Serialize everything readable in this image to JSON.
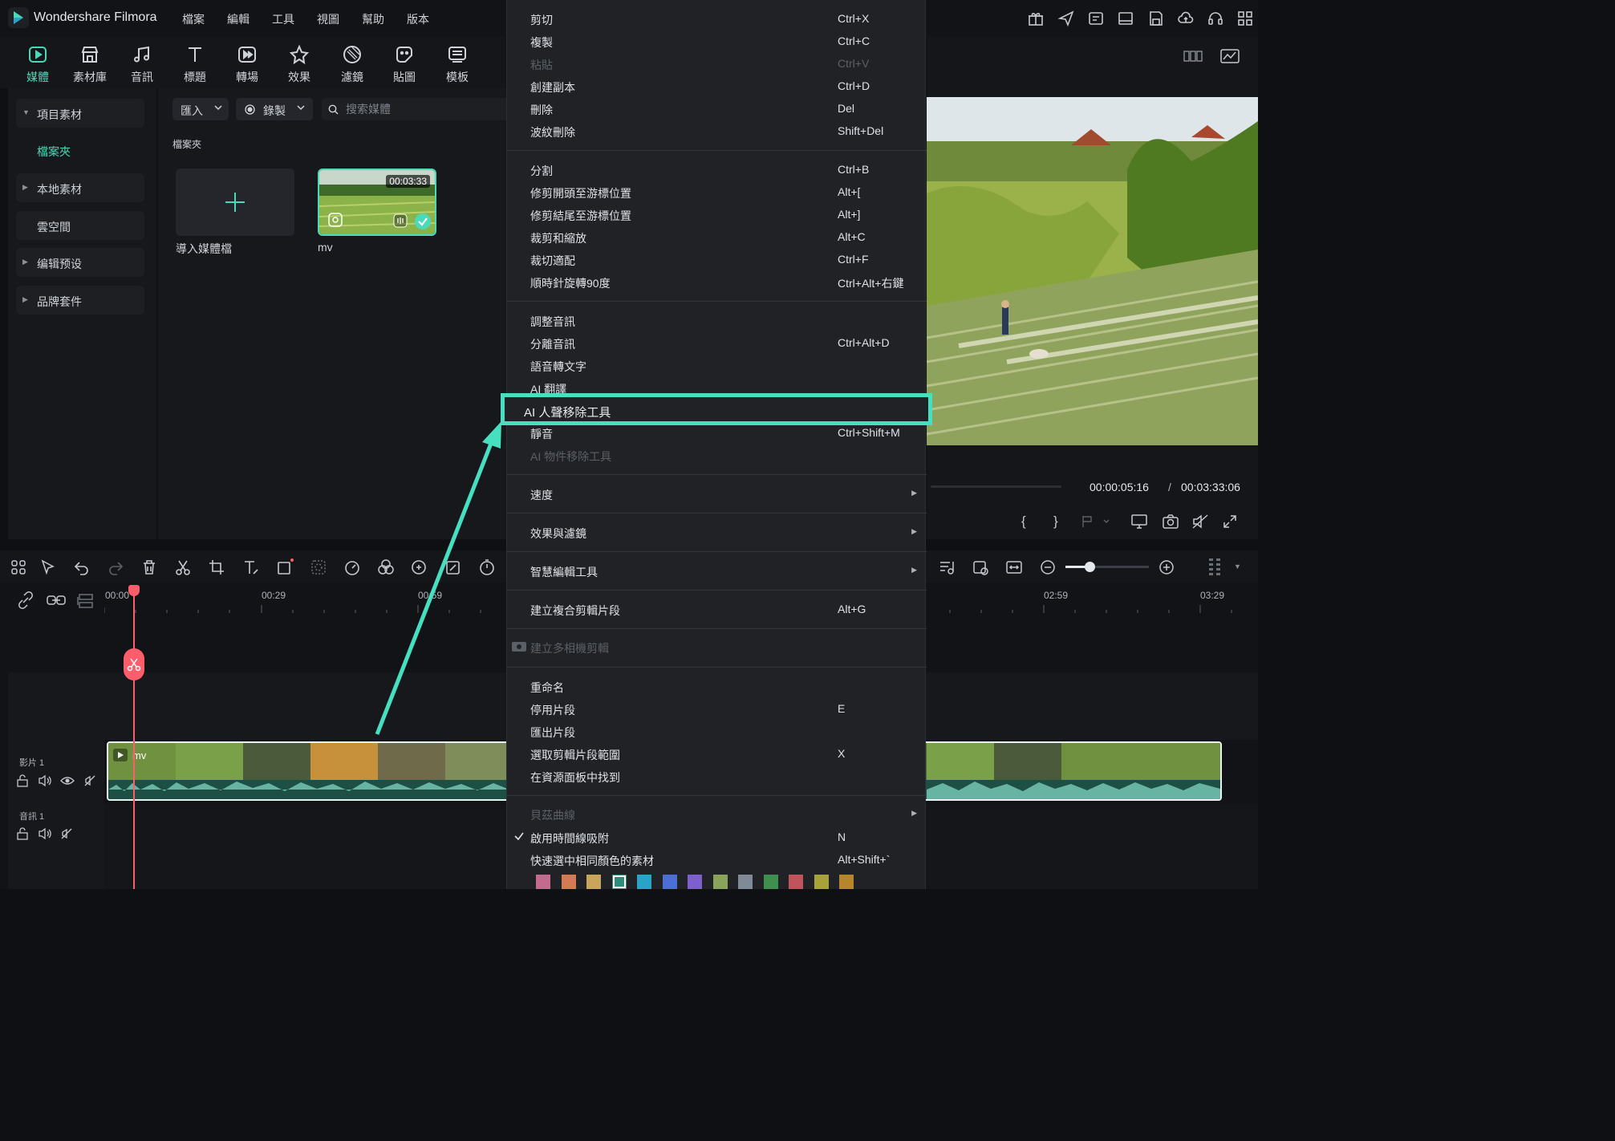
{
  "app": {
    "title": "Wondershare Filmora"
  },
  "menubar": [
    "檔案",
    "編輯",
    "工具",
    "視圖",
    "幫助",
    "版本"
  ],
  "main_toolbar": {
    "tabs": [
      {
        "label": "媒體",
        "icon": "media-icon",
        "active": true
      },
      {
        "label": "素材庫",
        "icon": "stock-icon"
      },
      {
        "label": "音訊",
        "icon": "music-icon"
      },
      {
        "label": "標題",
        "icon": "title-icon"
      },
      {
        "label": "轉場",
        "icon": "transition-icon"
      },
      {
        "label": "效果",
        "icon": "effects-icon"
      },
      {
        "label": "濾鏡",
        "icon": "filter-icon"
      },
      {
        "label": "貼圖",
        "icon": "sticker-icon"
      },
      {
        "label": "模板",
        "icon": "template-icon"
      }
    ],
    "accent": "#4ad9b9"
  },
  "left_panel": {
    "items": [
      {
        "label": "項目素材",
        "expanded": true
      },
      {
        "label": "檔案夾",
        "selected": true
      },
      {
        "label": "本地素材"
      },
      {
        "label": "雲空間"
      },
      {
        "label": "编辑预设"
      },
      {
        "label": "品牌套件"
      }
    ]
  },
  "media_panel": {
    "import_dropdown": "匯入",
    "record_dropdown": "錄製",
    "search_placeholder": "搜索媒體",
    "folder_label": "檔案夾",
    "import_tile_label": "導入媒體檔",
    "clip": {
      "name": "mv",
      "duration": "00:03:33"
    }
  },
  "preview": {
    "current_time": "00:00:05:16",
    "separator": "/",
    "total_time": "00:03:33:06"
  },
  "timeline": {
    "ruler_labels": [
      "00:00",
      "00:29",
      "00:59",
      "02:59",
      "03:29"
    ],
    "tracks": [
      {
        "label": "影片 1"
      },
      {
        "label": "音訊 1"
      }
    ],
    "clip_label": "mv",
    "playhead_color": "#ff5c6c"
  },
  "context_menu": {
    "groups": [
      [
        {
          "label": "剪切",
          "shortcut": "Ctrl+X"
        },
        {
          "label": "複製",
          "shortcut": "Ctrl+C"
        },
        {
          "label": "粘貼",
          "shortcut": "Ctrl+V",
          "disabled": true
        },
        {
          "label": "創建副本",
          "shortcut": "Ctrl+D"
        },
        {
          "label": "刪除",
          "shortcut": "Del"
        },
        {
          "label": "波紋刪除",
          "shortcut": "Shift+Del"
        }
      ],
      [
        {
          "label": "分割",
          "shortcut": "Ctrl+B"
        },
        {
          "label": "修剪開頭至游標位置",
          "shortcut": "Alt+["
        },
        {
          "label": "修剪結尾至游標位置",
          "shortcut": "Alt+]"
        },
        {
          "label": "裁剪和縮放",
          "shortcut": "Alt+C"
        },
        {
          "label": "裁切適配",
          "shortcut": "Ctrl+F"
        },
        {
          "label": "順時針旋轉90度",
          "shortcut": "Ctrl+Alt+右鍵"
        }
      ],
      [
        {
          "label": "調整音訊",
          "shortcut": ""
        },
        {
          "label": "分離音訊",
          "shortcut": "Ctrl+Alt+D"
        },
        {
          "label": "語音轉文字",
          "shortcut": ""
        },
        {
          "label": "AI 翻譯",
          "shortcut": ""
        },
        {
          "label": "AI 人聲移除工具",
          "shortcut": "",
          "highlighted": true
        },
        {
          "label": "靜音",
          "shortcut": "Ctrl+Shift+M"
        },
        {
          "label": "AI 物件移除工具",
          "shortcut": "",
          "disabled": true
        }
      ],
      [
        {
          "label": "速度",
          "submenu": true
        }
      ],
      [
        {
          "label": "效果與濾鏡",
          "submenu": true
        }
      ],
      [
        {
          "label": "智慧編輯工具",
          "submenu": true
        }
      ],
      [
        {
          "label": "建立複合剪輯片段",
          "shortcut": "Alt+G"
        }
      ],
      [
        {
          "label": "建立多相機剪輯",
          "disabled": true
        }
      ],
      [
        {
          "label": "重命名",
          "shortcut": ""
        },
        {
          "label": "停用片段",
          "shortcut": "E"
        },
        {
          "label": "匯出片段",
          "shortcut": ""
        },
        {
          "label": "選取剪輯片段範圍",
          "shortcut": "X"
        },
        {
          "label": "在資源面板中找到",
          "shortcut": ""
        }
      ],
      [
        {
          "label": "貝茲曲線",
          "disabled": true,
          "submenu": true
        },
        {
          "label": "啟用時間線吸附",
          "shortcut": "N",
          "checked": true
        },
        {
          "label": "快速選中相同顏色的素材",
          "shortcut": "Alt+Shift+`"
        }
      ]
    ],
    "color_swatches": [
      "#c46a8e",
      "#d47a55",
      "#c9a55a",
      "#2e8d7a",
      "#2aa3c8",
      "#4c6fd6",
      "#7d5fd0",
      "#8aa35a",
      "#7f8a96",
      "#3f8f4f",
      "#c0545c",
      "#a8a23a",
      "#b8862a"
    ],
    "highlight_color": "#46e0c0"
  }
}
